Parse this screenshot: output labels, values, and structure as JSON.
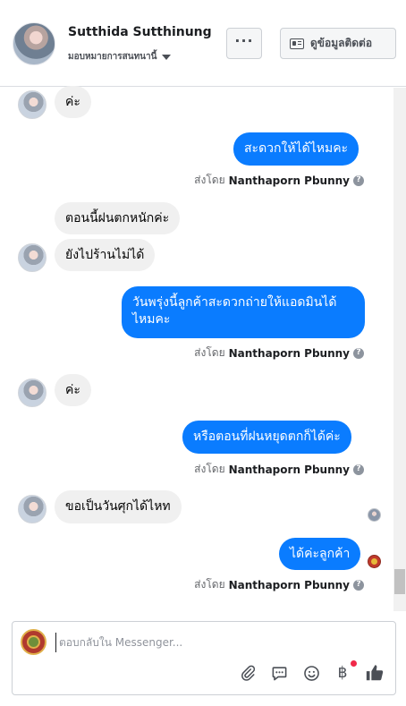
{
  "header": {
    "contact_name": "Sutthida Sutthinung",
    "assign_label": "มอบหมายการสนทนานี้",
    "more_label": "···",
    "info_button_label": "ดูข้อมูลติดต่อ",
    "icons": {
      "more": "more-icon",
      "info": "contact-card-icon",
      "assign": "caret-down-icon"
    }
  },
  "messages": [
    {
      "direction": "in",
      "text": "ค่ะ"
    },
    {
      "direction": "out",
      "text": "สะดวกให้ได้ไหมคะ",
      "sent_by_prefix": "ส่งโดย",
      "sent_by_name": "Nanthaporn Pbunny"
    },
    {
      "direction": "in",
      "text": "ตอนนี้ฝนตกหนักค่ะ"
    },
    {
      "direction": "in",
      "text": "ยังไปร้านไม่ได้"
    },
    {
      "direction": "out",
      "text": "วันพรุ่งนี้ลูกค้าสะดวกถ่ายให้แอดมินได้ไหมคะ",
      "sent_by_prefix": "ส่งโดย",
      "sent_by_name": "Nanthaporn Pbunny"
    },
    {
      "direction": "in",
      "text": "ค่ะ"
    },
    {
      "direction": "out",
      "text": "หรือตอนที่ฝนหยุดตกก็ได้ค่ะ",
      "sent_by_prefix": "ส่งโดย",
      "sent_by_name": "Nanthaporn Pbunny"
    },
    {
      "direction": "in",
      "text": "ขอเป็นวันศุกได้ไหท"
    },
    {
      "direction": "out",
      "text": "ได้ค่ะลูกค้า",
      "sent_by_prefix": "ส่งโดย",
      "sent_by_name": "Nanthaporn Pbunny"
    }
  ],
  "help_glyph": "?",
  "composer": {
    "placeholder": "ตอบกลับใน Messenger...",
    "value": "",
    "tools": [
      "paperclip-icon",
      "saved-reply-icon",
      "emoji-icon",
      "baht-icon",
      "thumbs-up-icon"
    ],
    "baht_glyph": "฿"
  },
  "colors": {
    "outgoing": "#0a7cff",
    "incoming": "#f0f0f0",
    "notification": "#f02849"
  }
}
